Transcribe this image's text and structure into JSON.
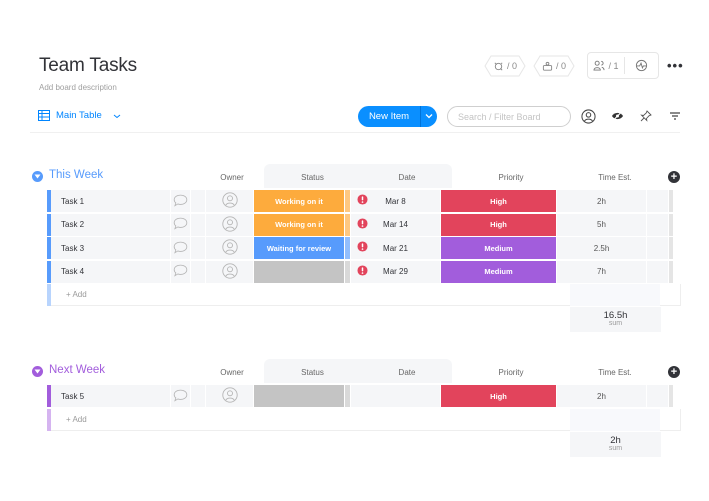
{
  "board": {
    "title": "Team Tasks",
    "description_placeholder": "Add board description",
    "view": {
      "label": "Main Table",
      "icon": "table-icon"
    }
  },
  "header_actions": {
    "integrations": {
      "icon": "integrations-icon",
      "count": "/ 0"
    },
    "automations": {
      "icon": "automations-icon",
      "count": "/ 0"
    },
    "members": {
      "icon": "members-icon",
      "count": "/ 1"
    },
    "activity": {
      "icon": "activity-icon"
    },
    "more": {
      "icon": "more-icon",
      "label": "•••"
    }
  },
  "toolbar": {
    "new_item_label": "New Item",
    "new_item_dropdown_icon": "chevron-down-icon",
    "search_placeholder": "Search / Filter Board",
    "person_filter_icon": "person-filter-icon",
    "hide_icon": "eye-hide-icon",
    "pin_icon": "pin-icon",
    "sort_icon": "sort-filter-icon"
  },
  "columns": {
    "owner": "Owner",
    "status": "Status",
    "date": "Date",
    "priority": "Priority",
    "time": "Time Est."
  },
  "colors": {
    "this_week": "#579bfc",
    "next_week": "#a25ddc",
    "working": "#fdab3d",
    "waiting": "#579bfc",
    "empty": "#c4c4c4",
    "high": "#e2445c",
    "medium": "#a25ddc",
    "alert": "#e2445c",
    "primary": "#0085ff"
  },
  "groups": [
    {
      "title": "This Week",
      "color": "#579bfc",
      "add_label": "+ Add",
      "sum_value": "16.5h",
      "sum_label": "sum",
      "rows": [
        {
          "name": "Task 1",
          "status": "Working on it",
          "status_color": "#fdab3d",
          "date": "Mar 8",
          "alert": true,
          "priority": "High",
          "priority_color": "#e2445c",
          "time": "2h"
        },
        {
          "name": "Task 2",
          "status": "Working on it",
          "status_color": "#fdab3d",
          "date": "Mar 14",
          "alert": true,
          "priority": "High",
          "priority_color": "#e2445c",
          "time": "5h"
        },
        {
          "name": "Task 3",
          "status": "Waiting for review",
          "status_color": "#579bfc",
          "date": "Mar 21",
          "alert": true,
          "priority": "Medium",
          "priority_color": "#a25ddc",
          "time": "2.5h"
        },
        {
          "name": "Task 4",
          "status": "",
          "status_color": "#c4c4c4",
          "date": "Mar 29",
          "alert": true,
          "priority": "Medium",
          "priority_color": "#a25ddc",
          "time": "7h"
        }
      ]
    },
    {
      "title": "Next Week",
      "color": "#a25ddc",
      "add_label": "+ Add",
      "sum_value": "2h",
      "sum_label": "sum",
      "rows": [
        {
          "name": "Task 5",
          "status": "",
          "status_color": "#c4c4c4",
          "date": "",
          "alert": false,
          "priority": "High",
          "priority_color": "#e2445c",
          "time": "2h"
        }
      ]
    }
  ]
}
